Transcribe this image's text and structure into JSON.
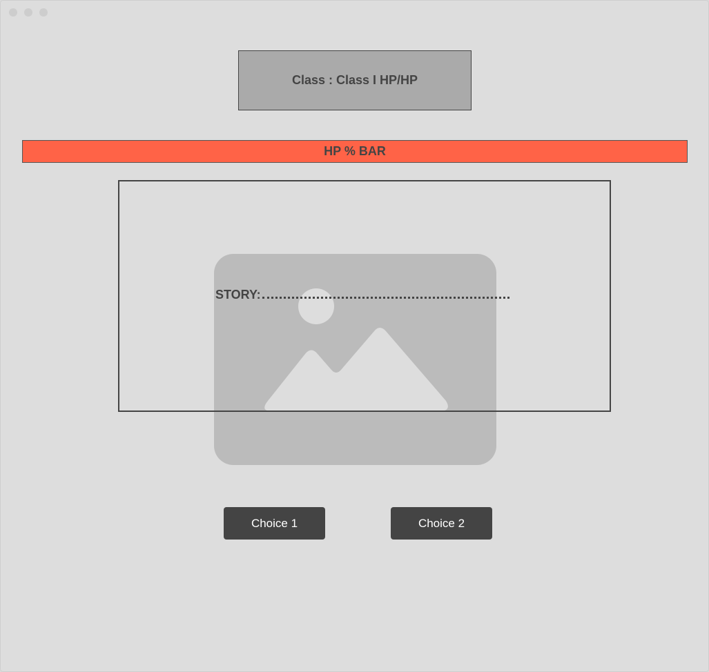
{
  "window": {
    "controls": [
      "close",
      "minimize",
      "maximize"
    ]
  },
  "header": {
    "class_label": "Class : Class I HP/HP"
  },
  "hp_bar": {
    "label": "HP % BAR",
    "color": "#ff6347"
  },
  "story": {
    "label": "STORY:",
    "image_icon": "image-placeholder-icon"
  },
  "choices": [
    {
      "label": "Choice 1"
    },
    {
      "label": "Choice 2"
    }
  ],
  "colors": {
    "background": "#dddddd",
    "button": "#444444",
    "button_text": "#ffffff",
    "class_box": "#aaaaaa",
    "image_placeholder": "#bbbbbb"
  }
}
